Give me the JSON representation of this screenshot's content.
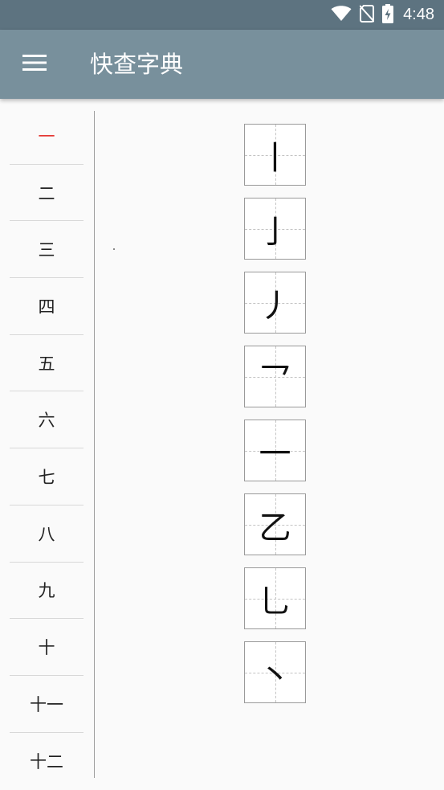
{
  "status_bar": {
    "time": "4:48",
    "icons": [
      "wifi-icon",
      "no-sim-icon",
      "battery-charging-icon"
    ]
  },
  "app_bar": {
    "menu_icon": "hamburger-menu-icon",
    "title": "快查字典"
  },
  "stroke_counts": {
    "selected_index": 0,
    "items": [
      "一",
      "二",
      "三",
      "四",
      "五",
      "六",
      "七",
      "八",
      "九",
      "十",
      "十一",
      "十二"
    ]
  },
  "strokes": [
    "丨",
    "亅",
    "丿",
    "乛",
    "一",
    "乙",
    "乚",
    "丶"
  ],
  "colors": {
    "status_bar": "#5d7380",
    "app_bar": "#78909c",
    "selected": "#e53935",
    "background": "#fafafa"
  }
}
